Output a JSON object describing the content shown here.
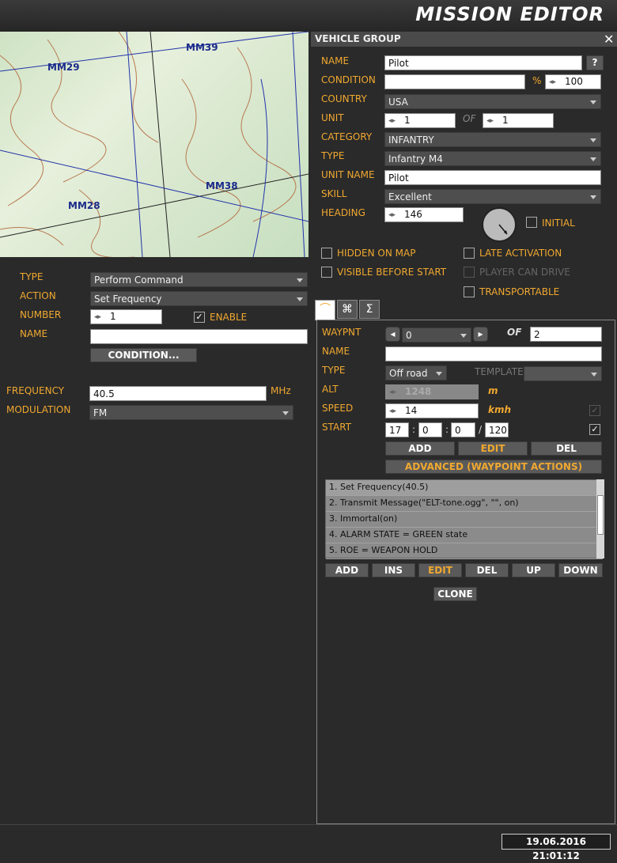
{
  "header": {
    "title": "MISSION EDITOR"
  },
  "map": {
    "labels": [
      "MM29",
      "MM39",
      "MM38",
      "MM28"
    ]
  },
  "left": {
    "type_label": "TYPE",
    "type_value": "Perform Command",
    "action_label": "ACTION",
    "action_value": "Set Frequency",
    "number_label": "NUMBER",
    "number_value": "1",
    "enable_label": "ENABLE",
    "name_label": "NAME",
    "name_value": "",
    "condition_btn": "CONDITION...",
    "frequency_label": "FREQUENCY",
    "frequency_value": "40.5",
    "frequency_unit": "MHz",
    "modulation_label": "MODULATION",
    "modulation_value": "FM"
  },
  "group": {
    "title": "VEHICLE GROUP",
    "name_label": "NAME",
    "name_value": "Pilot",
    "help": "?",
    "condition_label": "CONDITION",
    "condition_value": "",
    "percent": "%",
    "percent_value": "100",
    "country_label": "COUNTRY",
    "country_value": "USA",
    "unit_label": "UNIT",
    "unit_value": "1",
    "of_label": "OF",
    "unit_of": "1",
    "category_label": "CATEGORY",
    "category_value": "INFANTRY",
    "type_label": "TYPE",
    "type_value": "Infantry M4",
    "unitname_label": "UNIT NAME",
    "unitname_value": "Pilot",
    "skill_label": "SKILL",
    "skill_value": "Excellent",
    "heading_label": "HEADING",
    "heading_value": "146",
    "initial_label": "INITIAL",
    "hidden_label": "HIDDEN ON MAP",
    "late_label": "LATE ACTIVATION",
    "visible_label": "VISIBLE BEFORE START",
    "player_label": "PLAYER CAN DRIVE",
    "transport_label": "TRANSPORTABLE"
  },
  "tabs": {
    "route": "route-icon",
    "trigger": "command-icon",
    "sum": "Σ"
  },
  "waypoint": {
    "wp_label": "WAYPNT",
    "wp_value": "0",
    "of_label": "OF",
    "wp_of": "2",
    "name_label": "NAME",
    "name_value": "",
    "type_label": "TYPE",
    "type_value": "Off road",
    "template_label": "TEMPLATE",
    "alt_label": "ALT",
    "alt_value": "1248",
    "alt_unit": "m",
    "speed_label": "SPEED",
    "speed_value": "14",
    "speed_unit": "kmh",
    "start_label": "START",
    "start_h": "17",
    "start_m": "0",
    "start_s": "0",
    "start_d": "120",
    "add": "ADD",
    "edit": "EDIT",
    "del": "DEL",
    "advanced": "ADVANCED (WAYPOINT ACTIONS)",
    "actions": [
      "1. Set Frequency(40.5)",
      "2. Transmit Message(\"ELT-tone.ogg\", \"\", on)",
      "3. Immortal(on)",
      "4. ALARM STATE = GREEN state",
      "5. ROE = WEAPON HOLD"
    ],
    "list_add": "ADD",
    "list_ins": "INS",
    "list_edit": "EDIT",
    "list_del": "DEL",
    "list_up": "UP",
    "list_down": "DOWN",
    "clone": "CLONE"
  },
  "footer": {
    "datetime": "19.06.2016 21:01:12"
  }
}
